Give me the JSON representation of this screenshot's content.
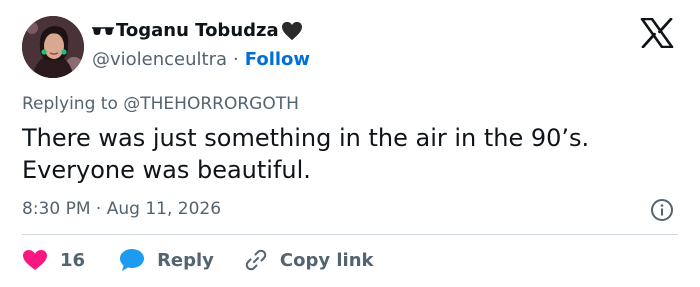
{
  "author": {
    "display_name": "Toganu Tobudza",
    "handle": "@violenceultra",
    "separator": "·",
    "follow_label": "Follow",
    "name_prefix_emoji": "sunglasses-icon",
    "name_suffix_emoji": "black-heart-icon"
  },
  "reply_context": {
    "prefix": "Replying to",
    "mention": "@THEHORRORGOTH"
  },
  "tweet": {
    "lines": [
      "There was just something in the air in the 90’s.",
      "Everyone was beautiful."
    ]
  },
  "meta": {
    "time": "8:30 PM",
    "separator": "·",
    "date": "Aug 11, 2026"
  },
  "actions": {
    "like_count": "16",
    "reply_label": "Reply",
    "copy_label": "Copy link"
  },
  "icons": {
    "brand": "x-logo-icon",
    "like": "heart-icon",
    "reply": "speech-bubble-icon",
    "copy": "link-icon",
    "info": "info-icon"
  },
  "colors": {
    "text": "#0f1419",
    "secondary": "#536471",
    "link": "#006fd6",
    "like": "#f91880",
    "reply": "#1d9bf0",
    "divider": "#cfd9de"
  }
}
